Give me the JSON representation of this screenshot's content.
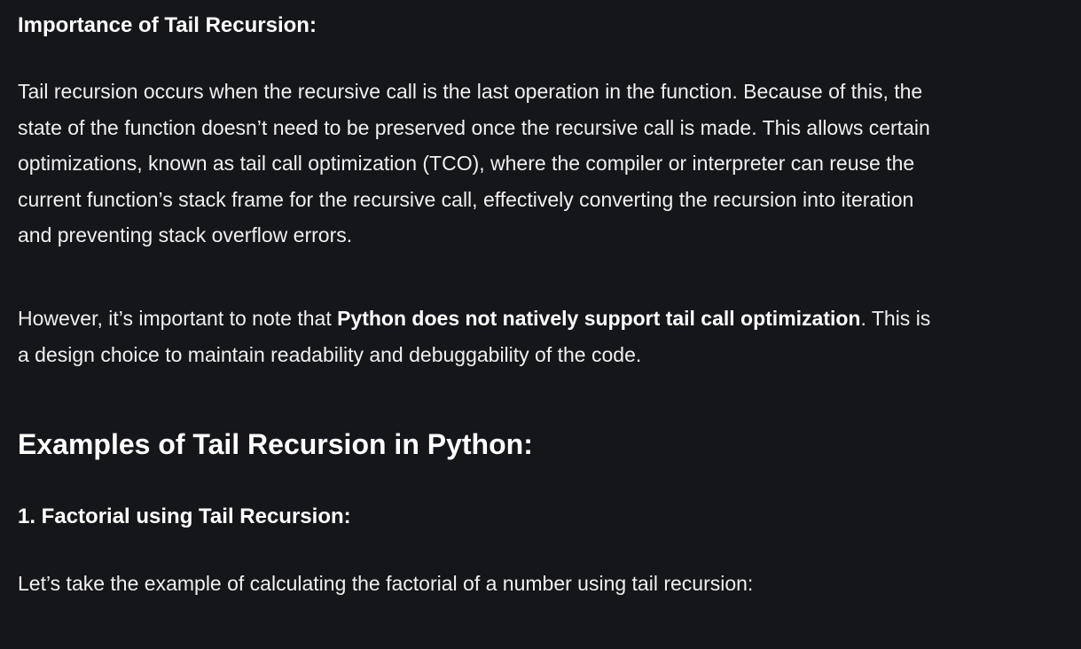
{
  "document": {
    "section_heading": "Importance of Tail Recursion:",
    "paragraph1": "Tail recursion occurs when the recursive call is the last operation in the function. Because of this, the state of the function doesn’t need to be preserved once the recursive call is made. This allows certain optimizations, known as tail call optimization (TCO), where the compiler or interpreter can reuse the current function’s stack frame for the recursive call, effectively converting the recursion into iteration and preventing stack overflow errors.",
    "paragraph2": {
      "before": "However, it’s important to note that ",
      "bold": "Python does not natively support tail call optimization",
      "after": ". This is a design choice to maintain readability and debuggability of the code."
    },
    "examples_heading": "Examples of Tail Recursion in Python:",
    "factorial_heading": "1. Factorial using Tail Recursion:",
    "paragraph3": "Let’s take the example of calculating the factorial of a number using tail recursion:"
  }
}
